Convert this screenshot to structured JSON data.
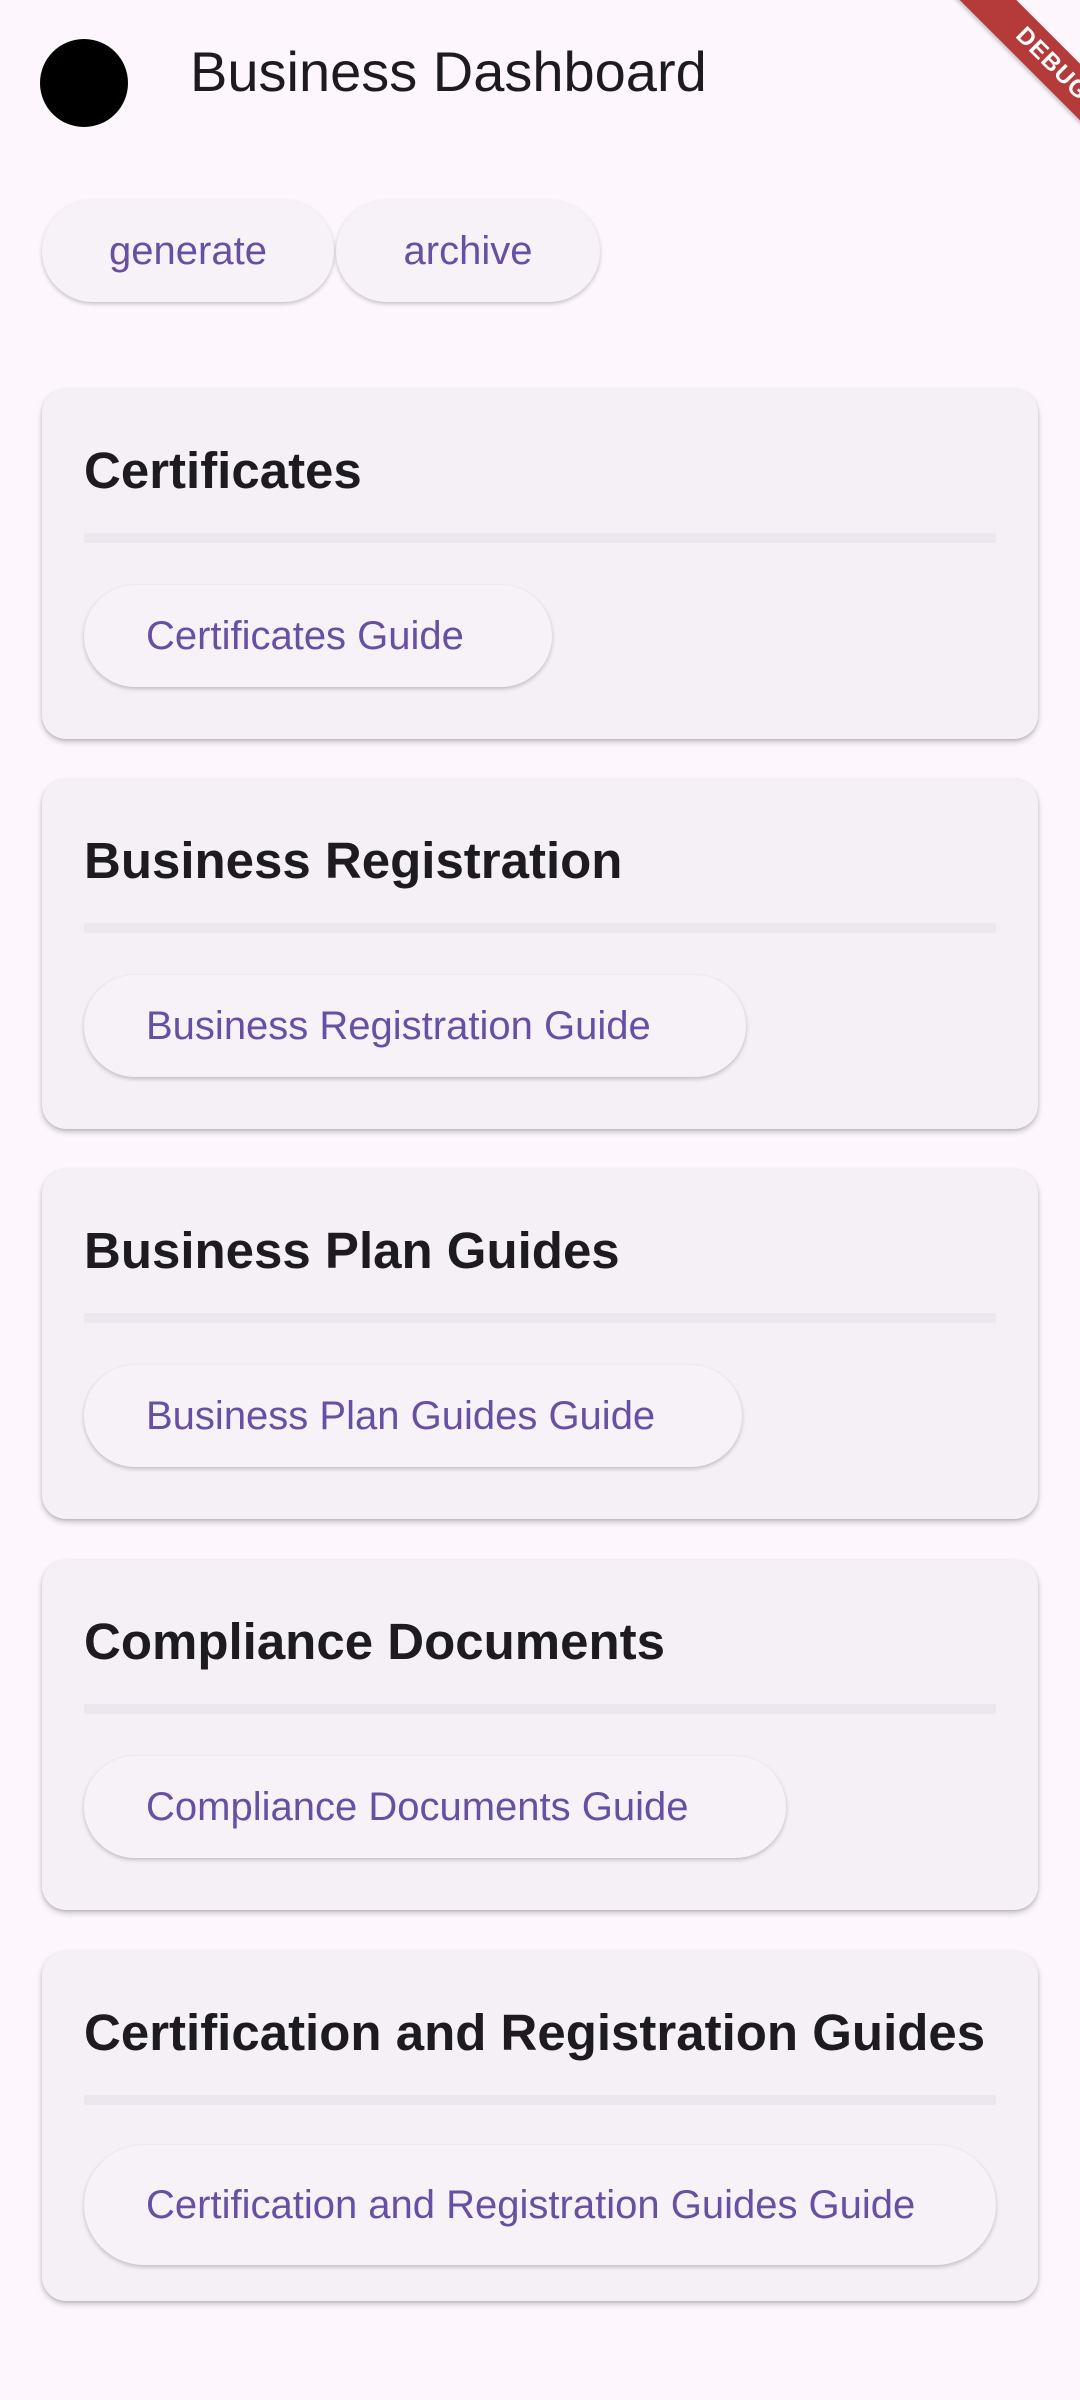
{
  "app_bar": {
    "title": "Business Dashboard",
    "avatar_icon": "avatar-circle"
  },
  "debug_banner": "DEBUG",
  "actions": {
    "generate_label": "generate",
    "archive_label": "archive"
  },
  "colors": {
    "background": "#fdf7fd",
    "card": "#f5f0f6",
    "accent": "#6750a4",
    "debug_banner": "#b53a3a"
  },
  "cards": [
    {
      "title": "Certificates",
      "button": "Certificates Guide"
    },
    {
      "title": "Business Registration",
      "button": "Business Registration Guide"
    },
    {
      "title": "Business Plan Guides",
      "button": "Business Plan Guides Guide"
    },
    {
      "title": "Compliance Documents",
      "button": "Compliance Documents Guide"
    },
    {
      "title": "Certification and Registration Guides",
      "button": "Certification and Registration Guides Guide"
    }
  ]
}
